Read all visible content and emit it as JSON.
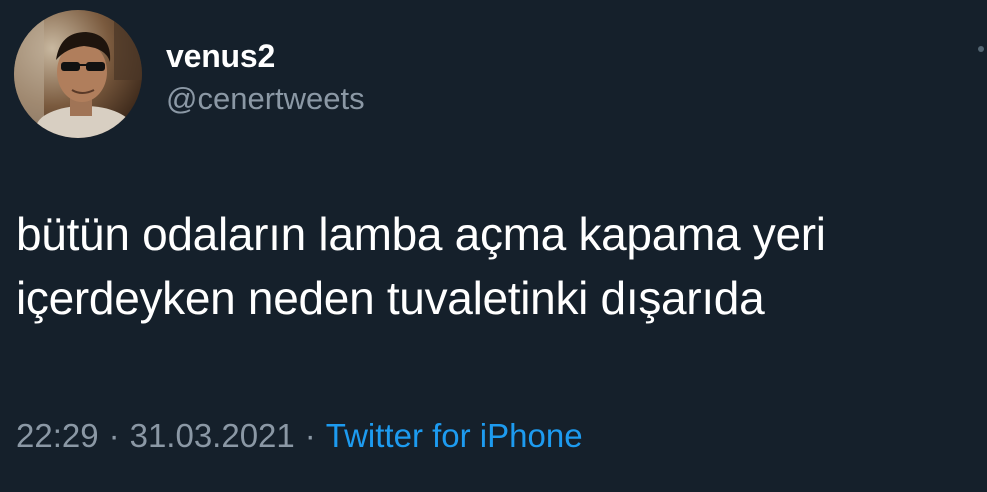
{
  "tweet": {
    "author": {
      "display_name": "venus2",
      "handle": "@cenertweets",
      "avatar": "profile-photo-icon"
    },
    "text_lines": [
      "bütün odaların lamba açma kapama yeri",
      "içerdeyken neden tuvaletinki dışarıda"
    ],
    "time": "22:29",
    "date": "31.03.2021",
    "separator": "·",
    "source": "Twitter for iPhone"
  },
  "colors": {
    "background": "#15202b",
    "primary_text": "#ffffff",
    "secondary_text": "#8b98a5",
    "accent": "#1d9bf0"
  }
}
